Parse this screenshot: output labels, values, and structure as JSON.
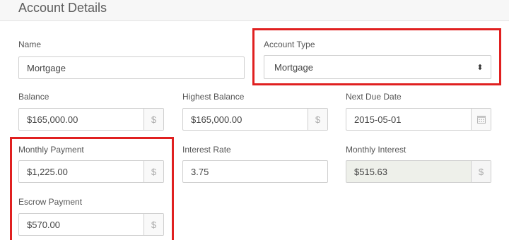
{
  "header": {
    "title": "Account Details"
  },
  "form": {
    "name": {
      "label": "Name",
      "value": "Mortgage"
    },
    "account_type": {
      "label": "Account Type",
      "value": "Mortgage",
      "arrow_glyph": "⬍"
    },
    "balance": {
      "label": "Balance",
      "value": "$165,000.00",
      "addon": "$"
    },
    "highest_balance": {
      "label": "Highest Balance",
      "value": "$165,000.00",
      "addon": "$"
    },
    "next_due_date": {
      "label": "Next Due Date",
      "value": "2015-05-01",
      "icon": "calendar-icon"
    },
    "monthly_payment": {
      "label": "Monthly Payment",
      "value": "$1,225.00",
      "addon": "$"
    },
    "interest_rate": {
      "label": "Interest Rate",
      "value": "3.75"
    },
    "monthly_interest": {
      "label": "Monthly Interest",
      "value": "$515.63",
      "addon": "$"
    },
    "escrow_payment": {
      "label": "Escrow Payment",
      "value": "$570.00",
      "addon": "$"
    }
  },
  "colors": {
    "highlight": "#e02020",
    "readonly_bg": "#eef0ea"
  }
}
